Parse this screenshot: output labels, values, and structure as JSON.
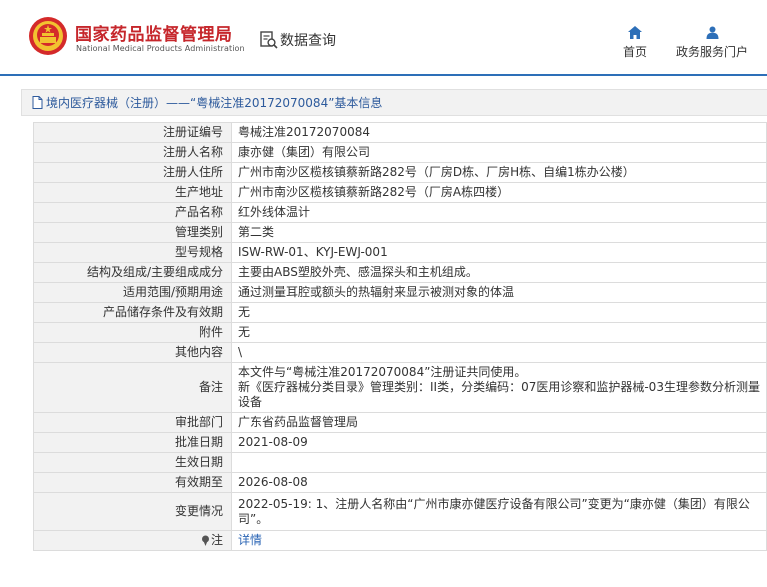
{
  "header": {
    "brand_cn": "国家药品监督管理局",
    "brand_en": "National Medical Products Administration",
    "query_label": "数据查询",
    "nav": [
      {
        "label": "首页",
        "icon": "home-icon"
      },
      {
        "label": "政务服务门户",
        "icon": "user-icon"
      }
    ],
    "accent_color": "#2d6fb8",
    "brand_color": "#c6262b"
  },
  "breadcrumb": {
    "text": "境内医疗器械（注册）——“粤械注准20172070084”基本信息"
  },
  "table": {
    "rows": [
      {
        "key": "注册证编号",
        "value": "粤械注准20172070084"
      },
      {
        "key": "注册人名称",
        "value": "康亦健（集团）有限公司"
      },
      {
        "key": "注册人住所",
        "value": "广州市南沙区榄核镇蔡新路282号（厂房D栋、厂房H栋、自编1栋办公楼）"
      },
      {
        "key": "生产地址",
        "value": "广州市南沙区榄核镇蔡新路282号（厂房A栋四楼）"
      },
      {
        "key": "产品名称",
        "value": "红外线体温计"
      },
      {
        "key": "管理类别",
        "value": "第二类"
      },
      {
        "key": "型号规格",
        "value": "ISW-RW-01、KYJ-EWJ-001"
      },
      {
        "key": "结构及组成/主要组成成分",
        "value": "主要由ABS塑胶外壳、感温探头和主机组成。"
      },
      {
        "key": "适用范围/预期用途",
        "value": "通过测量耳腔或额头的热辐射来显示被测对象的体温"
      },
      {
        "key": "产品储存条件及有效期",
        "value": "无"
      },
      {
        "key": "附件",
        "value": "无"
      },
      {
        "key": "其他内容",
        "value": "\\"
      },
      {
        "key": "备注",
        "value": "本文件与“粤械注准20172070084”注册证共同使用。\n新《医疗器械分类目录》管理类别：II类，分类编码：07医用诊察和监护器械-03生理参数分析测量设备"
      },
      {
        "key": "审批部门",
        "value": "广东省药品监督管理局"
      },
      {
        "key": "批准日期",
        "value": "2021-08-09"
      },
      {
        "key": "生效日期",
        "value": ""
      },
      {
        "key": "有效期至",
        "value": "2026-08-08"
      },
      {
        "key": "变更情况",
        "value": "2022-05-19: 1、注册人名称由“广州市康亦健医疗设备有限公司”变更为“康亦健（集团）有限公司”。"
      }
    ],
    "detail": {
      "key": "注",
      "link": "详情"
    }
  }
}
